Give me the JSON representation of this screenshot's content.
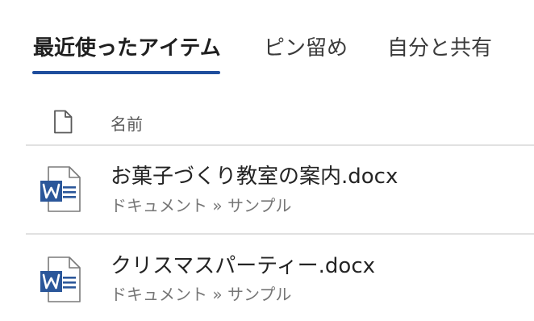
{
  "tabs": {
    "recent": "最近使ったアイテム",
    "pinned": "ピン留め",
    "shared": "自分と共有"
  },
  "list": {
    "name_header": "名前",
    "files": [
      {
        "name": "お菓子づくり教室の案内.docx",
        "path": "ドキュメント » サンプル",
        "icon": "word-document-icon"
      },
      {
        "name": "クリスマスパーティー.docx",
        "path": "ドキュメント » サンプル",
        "icon": "word-document-icon"
      }
    ]
  },
  "colors": {
    "accent": "#1f4e9d",
    "word_blue": "#2b579a",
    "divider": "#e1e1e1"
  }
}
